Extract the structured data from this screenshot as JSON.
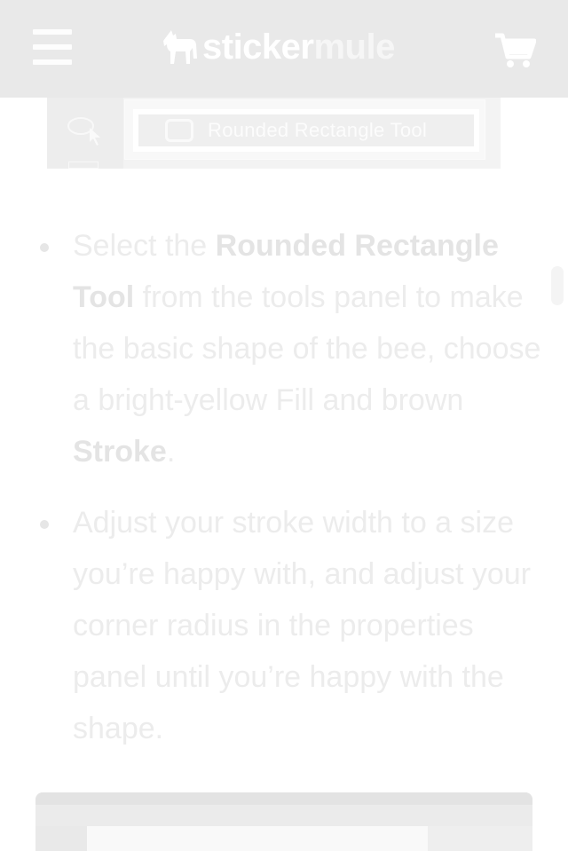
{
  "header": {
    "brand_part1": "sticker",
    "brand_part2": "mule"
  },
  "top_screenshot": {
    "tool_label": "Rounded Rectangle Tool"
  },
  "article": {
    "bullets": [
      {
        "pre": "Select the ",
        "bold1": "Rounded Rectangle Tool",
        "mid": " from the tools panel to make the basic shape of the bee, choose a bright-yellow Fill and brown ",
        "bold2": "Stroke",
        "post": "."
      },
      {
        "text": "Adjust your stroke width to a size you’re happy with, and adjust your corner radius in the properties panel until you’re happy with the shape."
      }
    ]
  },
  "icons": {
    "menu": "hamburger-icon",
    "logo": "mule-logo-icon",
    "cart": "cart-icon"
  }
}
